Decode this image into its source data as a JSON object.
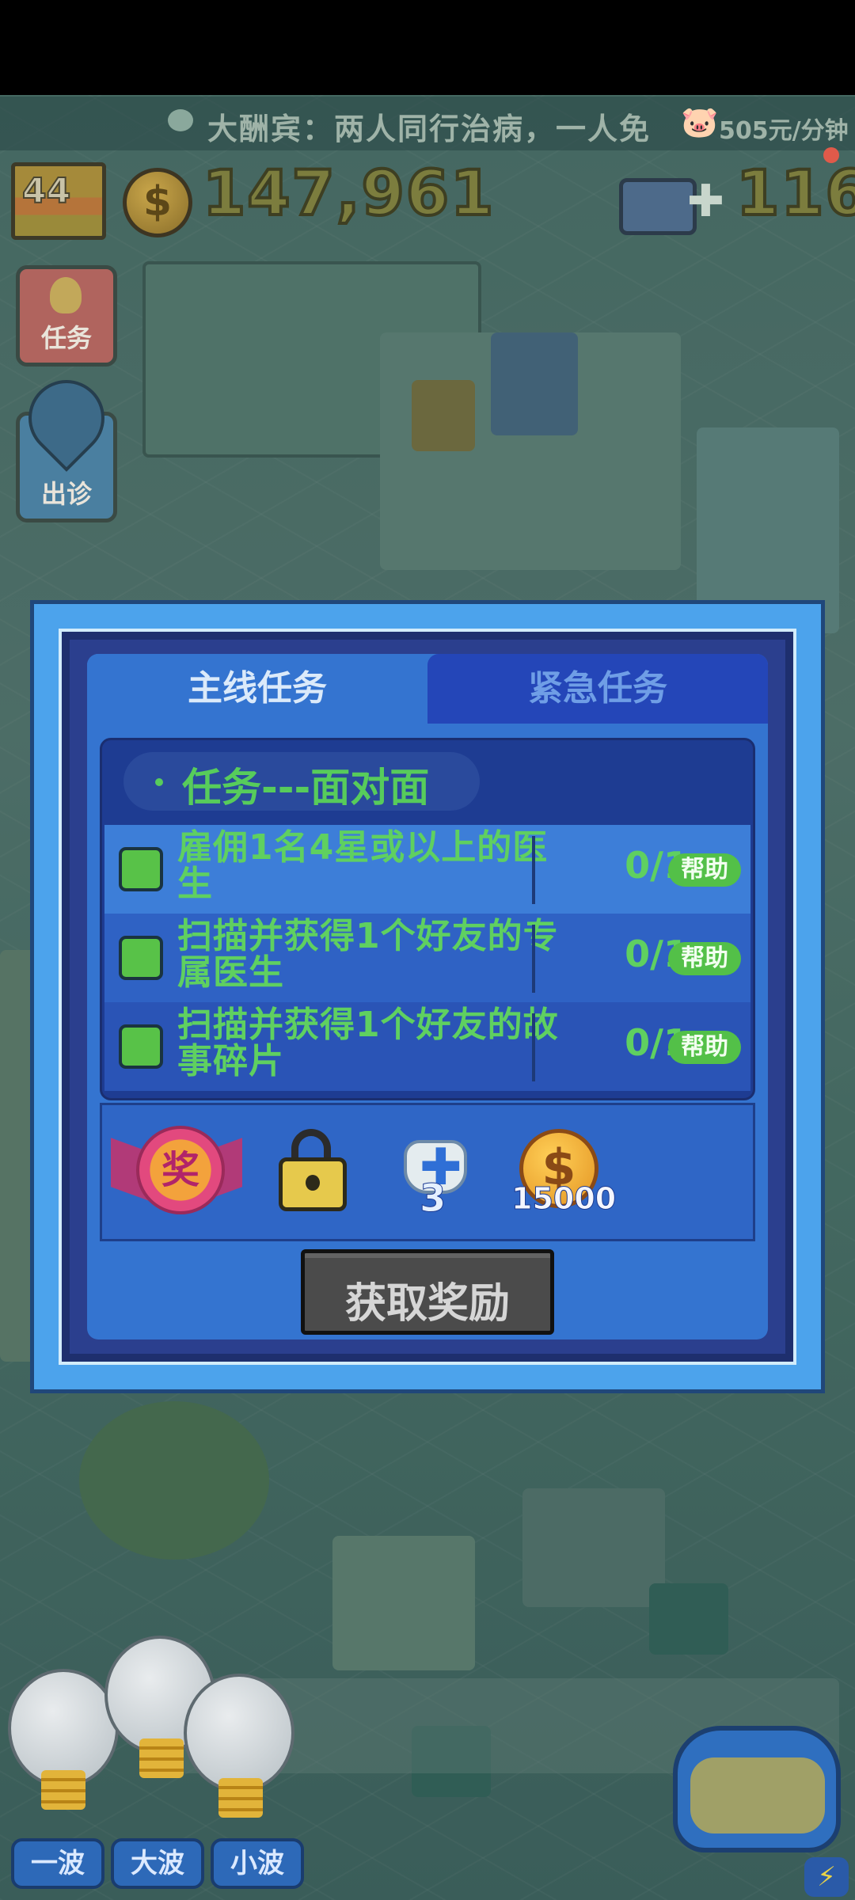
{
  "hud": {
    "ticker_message": "大酬宾：两人同行治病，一人免",
    "income_rate": "505元/分钟",
    "level": "44",
    "money": "147,961",
    "medkits": "116"
  },
  "side_buttons": {
    "task_label": "任务",
    "call_label": "出诊"
  },
  "dialog": {
    "tabs": [
      {
        "label": "主线任务",
        "active": true
      },
      {
        "label": "紧急任务",
        "active": false
      }
    ],
    "task_title": "任务---面对面",
    "tasks": [
      {
        "text": "雇佣1名4星或以上的医生",
        "progress": "0/1",
        "help_label": "帮助"
      },
      {
        "text": "扫描并获得1个好友的专属医生",
        "progress": "0/1",
        "help_label": "帮助"
      },
      {
        "text": "扫描并获得1个好友的故事碎片",
        "progress": "0/1",
        "help_label": "帮助"
      }
    ],
    "rewards": {
      "medal_char": "奖",
      "medkit_count": "3",
      "coin_amount": "15000"
    },
    "claim_label": "获取奖励"
  },
  "bottom": {
    "wave_buttons": [
      "一波",
      "大波",
      "小波"
    ]
  },
  "colors": {
    "task_green": "#5fd060",
    "panel_blue": "#3474d0",
    "frame_blue": "#4ca3ec"
  }
}
